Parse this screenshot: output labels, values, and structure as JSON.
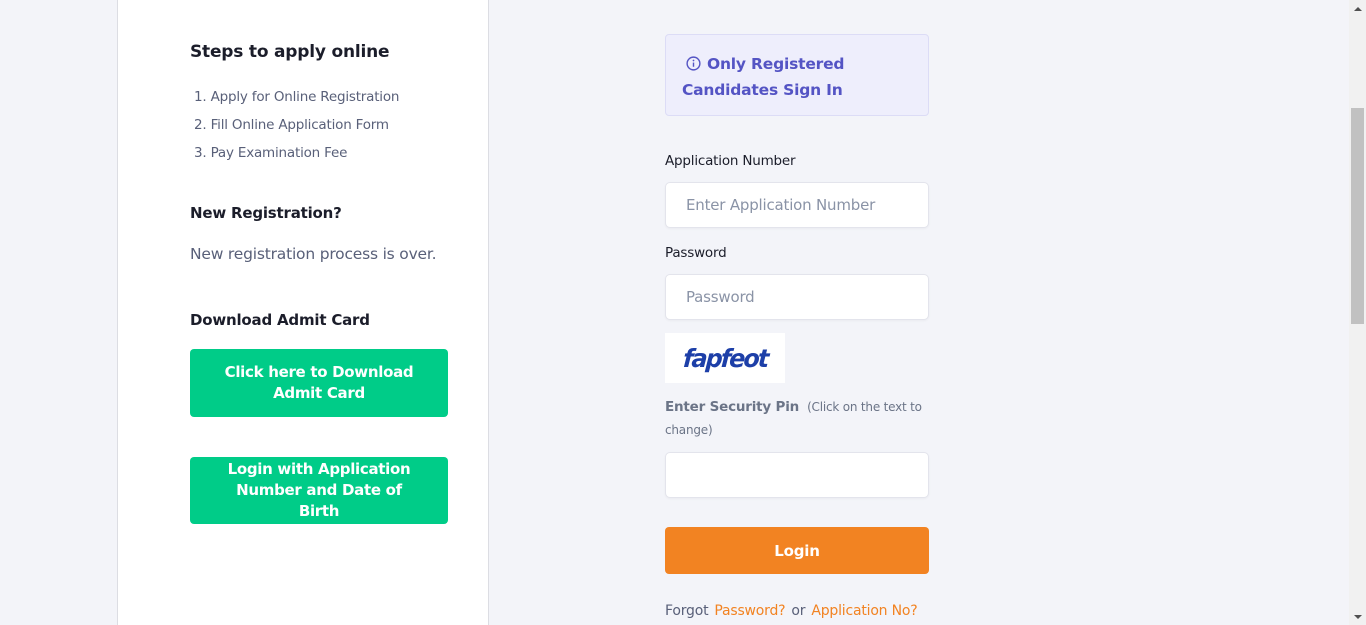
{
  "left": {
    "steps_heading": "Steps to apply online",
    "steps": [
      "1. Apply for Online Registration",
      "2. Fill Online Application Form",
      "3. Pay Examination Fee"
    ],
    "new_registration_heading": "New Registration?",
    "new_registration_text": "New registration process is over.",
    "admit_card_heading": "Download Admit Card",
    "download_admit_button": "Click here to Download Admit Card",
    "login_dob_button": "Login with Application Number and Date of Birth"
  },
  "login": {
    "notice_icon": "info-circle-icon",
    "notice_text": "Only Registered Candidates Sign In",
    "application_number_label": "Application Number",
    "application_number_placeholder": "Enter Application Number",
    "application_number_value": "",
    "password_label": "Password",
    "password_placeholder": "Password",
    "password_value": "",
    "captcha_text": "fapfeot",
    "security_pin_label": "Enter Security Pin",
    "security_pin_hint": "(Click on the text to change)",
    "security_pin_value": "",
    "login_button": "Login",
    "forgot_prefix": "Forgot",
    "forgot_password_link": "Password?",
    "forgot_or": "or",
    "forgot_application_link": "Application No?"
  },
  "colors": {
    "primary_green": "#00cc88",
    "accent_orange": "#f28322",
    "notice_purple": "#5454c4"
  }
}
